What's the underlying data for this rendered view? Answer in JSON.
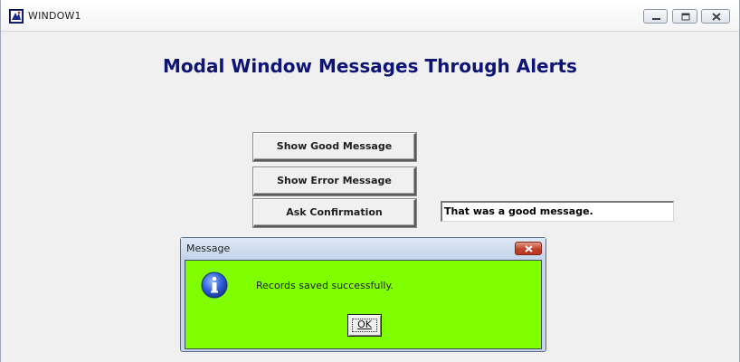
{
  "window": {
    "title": "WINDOW1",
    "icon": "app-icon",
    "controls": [
      "minimize-icon",
      "maximize-icon",
      "close-icon"
    ]
  },
  "main": {
    "heading": "Modal Window Messages Through Alerts",
    "buttons": {
      "good": "Show Good Message",
      "error": "Show Error Message",
      "confirm": "Ask Confirmation"
    },
    "result_field": {
      "value": "That was a good message."
    }
  },
  "dialog": {
    "title": "Message",
    "icon": "info-icon",
    "message": "Records saved successfully.",
    "ok_label": "OK",
    "background_color": "#80ff00"
  }
}
